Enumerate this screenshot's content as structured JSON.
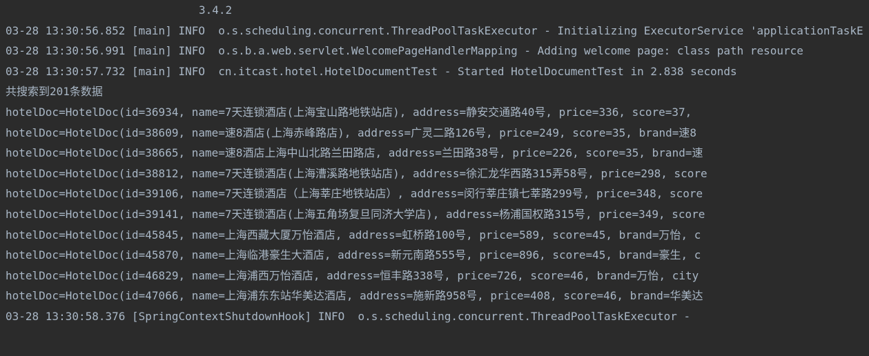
{
  "version_fragment": "3.4.2",
  "log_lines": [
    "03-28 13:30:56.852 [main] INFO  o.s.scheduling.concurrent.ThreadPoolTaskExecutor - Initializing ExecutorService 'applicationTaskExecutor'",
    "03-28 13:30:56.991 [main] INFO  o.s.b.a.web.servlet.WelcomePageHandlerMapping - Adding welcome page: class path resource",
    "03-28 13:30:57.732 [main] INFO  cn.itcast.hotel.HotelDocumentTest - Started HotelDocumentTest in 2.838 seconds"
  ],
  "search_summary": "共搜索到201条数据",
  "hotel_docs": [
    "hotelDoc=HotelDoc(id=36934, name=7天连锁酒店(上海宝山路地铁站店), address=静安交通路40号, price=336, score=37, ",
    "hotelDoc=HotelDoc(id=38609, name=速8酒店(上海赤峰路店), address=广灵二路126号, price=249, score=35, brand=速8",
    "hotelDoc=HotelDoc(id=38665, name=速8酒店上海中山北路兰田路店, address=兰田路38号, price=226, score=35, brand=速",
    "hotelDoc=HotelDoc(id=38812, name=7天连锁酒店(上海漕溪路地铁站店), address=徐汇龙华西路315弄58号, price=298, score",
    "hotelDoc=HotelDoc(id=39106, name=7天连锁酒店（上海莘庄地铁站店）, address=闵行莘庄镇七莘路299号, price=348, score",
    "hotelDoc=HotelDoc(id=39141, name=7天连锁酒店(上海五角场复旦同济大学店), address=杨浦国权路315号, price=349, score",
    "hotelDoc=HotelDoc(id=45845, name=上海西藏大厦万怡酒店, address=虹桥路100号, price=589, score=45, brand=万怡, c",
    "hotelDoc=HotelDoc(id=45870, name=上海临港豪生大酒店, address=新元南路555号, price=896, score=45, brand=豪生, c",
    "hotelDoc=HotelDoc(id=46829, name=上海浦西万怡酒店, address=恒丰路338号, price=726, score=46, brand=万怡, city",
    "hotelDoc=HotelDoc(id=47066, name=上海浦东东站华美达酒店, address=施新路958号, price=408, score=46, brand=华美达"
  ],
  "footer_log": "03-28 13:30:58.376 [SpringContextShutdownHook] INFO  o.s.scheduling.concurrent.ThreadPoolTaskExecutor - "
}
